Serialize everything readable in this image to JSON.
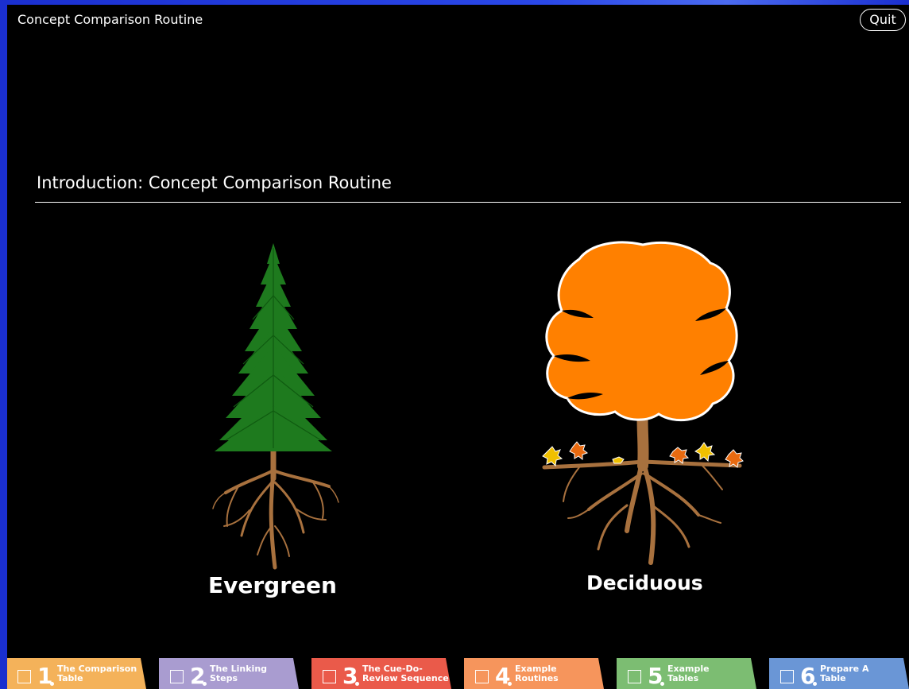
{
  "app": {
    "title": "Concept Comparison Routine",
    "quit_label": "Quit"
  },
  "section": {
    "title": "Introduction: Concept Comparison Routine"
  },
  "trees": {
    "left_label": "Evergreen",
    "right_label": "Deciduous"
  },
  "tabs": [
    {
      "number": "1",
      "label": "The Comparison\nTable",
      "color": "#f4b25a"
    },
    {
      "number": "2",
      "label": "The Linking\nSteps",
      "color": "#a99cd0"
    },
    {
      "number": "3",
      "label": "The Cue-Do-\nReview Sequence",
      "color": "#ea5a4a"
    },
    {
      "number": "4",
      "label": "Example\nRoutines",
      "color": "#f6955c"
    },
    {
      "number": "5",
      "label": "Example\nTables",
      "color": "#7cbd72"
    },
    {
      "number": "6",
      "label": "Prepare A\nTable",
      "color": "#6a96d6"
    }
  ],
  "colors": {
    "evergreen": "#1e7a1e",
    "deciduous": "#ff8000",
    "trunk": "#a8713e"
  }
}
